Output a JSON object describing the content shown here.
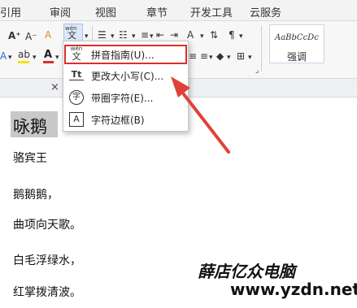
{
  "ribbon_tabs": [
    "引用",
    "审阅",
    "视图",
    "章节",
    "开发工具",
    "云服务"
  ],
  "ribbon": {
    "grow_font": "A⁺",
    "shrink_font": "A⁻",
    "clear_format": "A",
    "phonetic_top": "wén",
    "phonetic_bottom": "文",
    "font_color": "A",
    "highlight": "ab",
    "char_shade": "A",
    "style_sample": "AaBbCcDc",
    "style_name": "强调"
  },
  "menu": {
    "items": [
      {
        "label": "拼音指南(U)...",
        "icon": "pinyin-guide-icon",
        "highlighted": true
      },
      {
        "label": "更改大小写(C)...",
        "icon": "change-case-icon"
      },
      {
        "label": "带圈字符(E)...",
        "icon": "enclosed-char-icon",
        "icon_glyph": "字"
      },
      {
        "label": "字符边框(B)",
        "icon": "char-border-icon",
        "icon_glyph": "A"
      }
    ],
    "case_icon_text": "Tt"
  },
  "document": {
    "close_glyph": "×",
    "title": "咏鹅",
    "lines": [
      "骆宾王",
      "鹅鹅鹅，",
      "曲项向天歌。",
      "白毛浮绿水，",
      "红掌拨清波。"
    ]
  },
  "watermark": {
    "title": "薛店亿众电脑",
    "url": "www.yzdn.net"
  },
  "colors": {
    "highlight_box": "#d9302b",
    "arrow": "#e0423a",
    "text_highlight": "#c8c8c8"
  }
}
